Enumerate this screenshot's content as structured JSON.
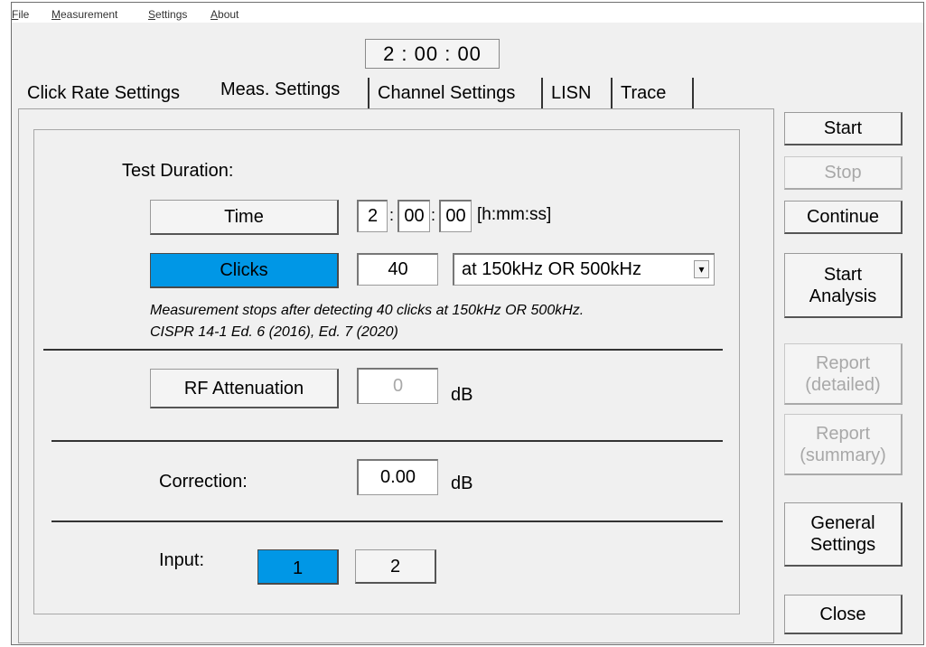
{
  "menu": {
    "file": {
      "hotkey": "F",
      "rest": "ile"
    },
    "measurement": {
      "hotkey": "M",
      "rest": "easurement"
    },
    "settings": {
      "hotkey": "S",
      "rest": "ettings"
    },
    "about": {
      "hotkey": "A",
      "rest": "bout"
    }
  },
  "timer": "2 : 00 : 00",
  "tabs": [
    {
      "label": "Click Rate Settings"
    },
    {
      "label": "Meas. Settings"
    },
    {
      "label": "Channel Settings"
    },
    {
      "label": "LISN"
    },
    {
      "label": "Trace"
    }
  ],
  "active_tab": "Meas. Settings",
  "test_duration": {
    "label": "Test Duration:",
    "time_button": "Time",
    "hours": "2",
    "minutes": "00",
    "seconds": "00",
    "colon": ":",
    "format": "[h:mm:ss]",
    "clicks_button": "Clicks",
    "clicks_value": "40",
    "clicks_mode": "at 150kHz OR 500kHz",
    "dropdown_arrow": "▾",
    "note_line1": "Measurement stops after detecting 40 clicks at 150kHz OR 500kHz.",
    "note_line2": "CISPR 14-1 Ed. 6 (2016), Ed. 7 (2020)"
  },
  "rf_attenuation": {
    "button": "RF Attenuation",
    "value": "0",
    "unit": "dB"
  },
  "correction": {
    "label": "Correction:",
    "value": "0.00",
    "unit": "dB"
  },
  "input": {
    "label": "Input:",
    "option1": "1",
    "option2": "2",
    "selected": "1"
  },
  "actions": {
    "start": "Start",
    "stop": "Stop",
    "continue": "Continue",
    "start_analysis_1": "Start",
    "start_analysis_2": "Analysis",
    "report_detailed_1": "Report",
    "report_detailed_2": "(detailed)",
    "report_summary_1": "Report",
    "report_summary_2": "(summary)",
    "general_settings_1": "General",
    "general_settings_2": "Settings",
    "close": "Close"
  },
  "colors": {
    "accent": "#0097e6",
    "disabled_text": "#a8a8a8"
  }
}
